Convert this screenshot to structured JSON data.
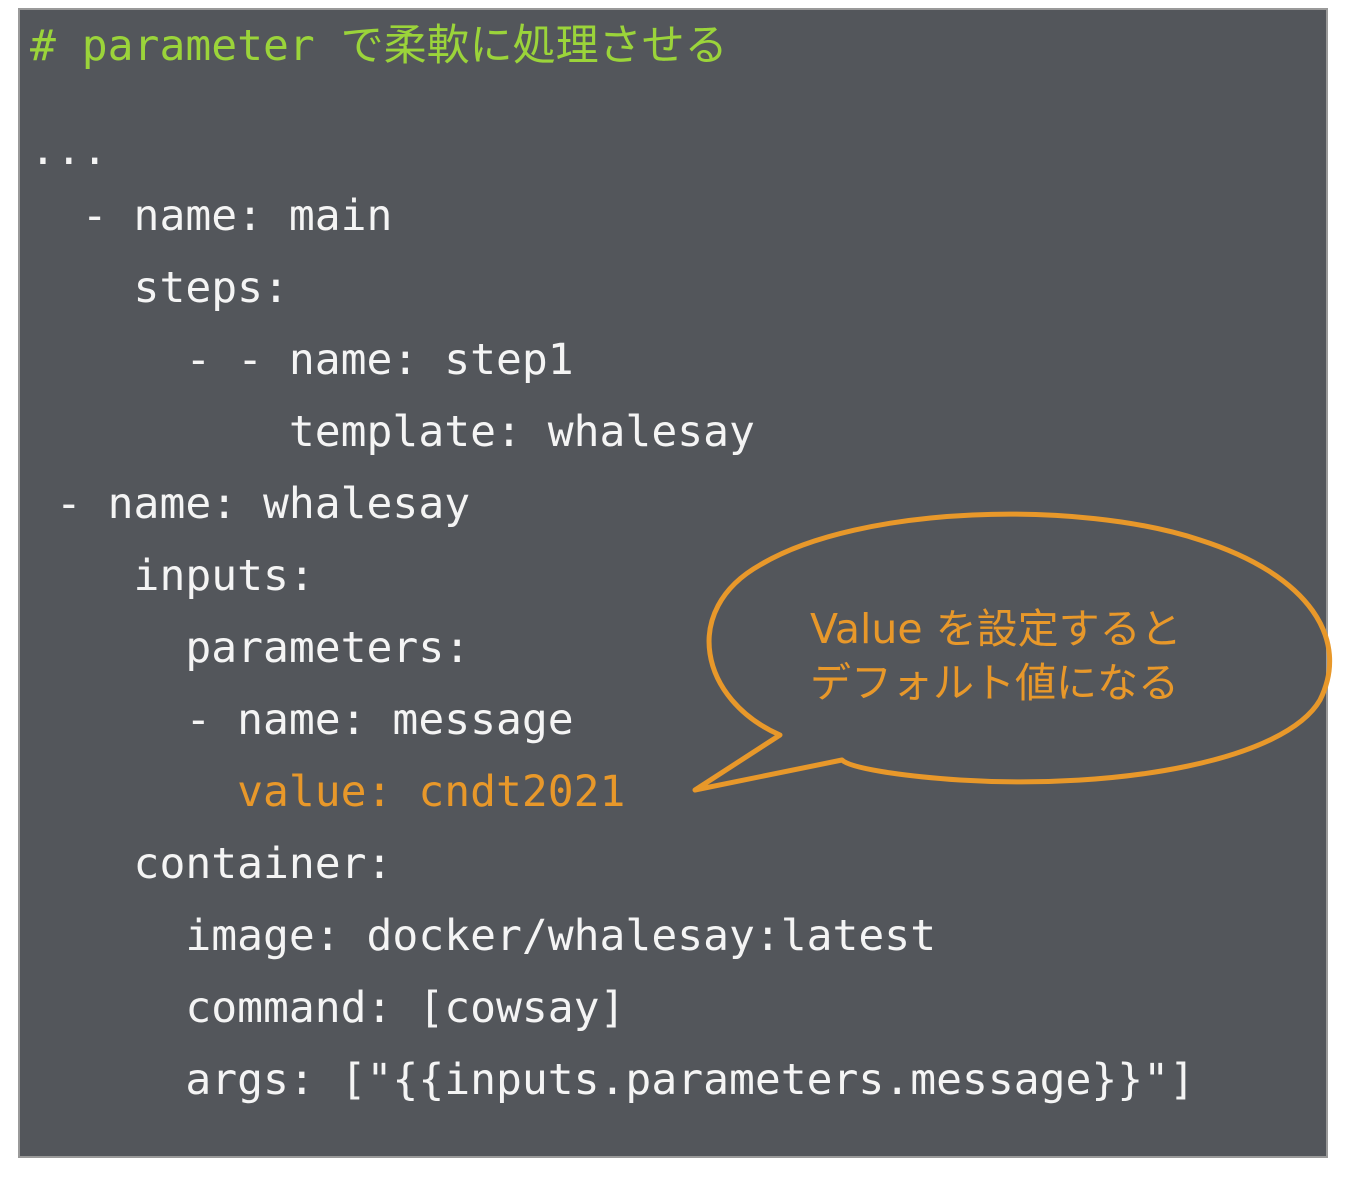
{
  "code": {
    "comment": "# parameter で柔軟に処理させる",
    "lines": [
      "...",
      "  - name: main",
      "    steps:",
      "      - - name: step1",
      "          template: whalesay",
      " - name: whalesay",
      "    inputs:",
      "      parameters:",
      "      - name: message",
      "        value: cndt2021",
      "    container:",
      "      image: docker/whalesay:latest",
      "      command: [cowsay]",
      "      args: [\"{{inputs.parameters.message}}\"]"
    ]
  },
  "callout": {
    "line1": "Value を設定すると",
    "line2": "デフォルト値になる"
  },
  "colors": {
    "background": "#53565b",
    "code_text": "#f4f4f4",
    "comment": "#9bd43a",
    "highlight": "#e8982a"
  }
}
